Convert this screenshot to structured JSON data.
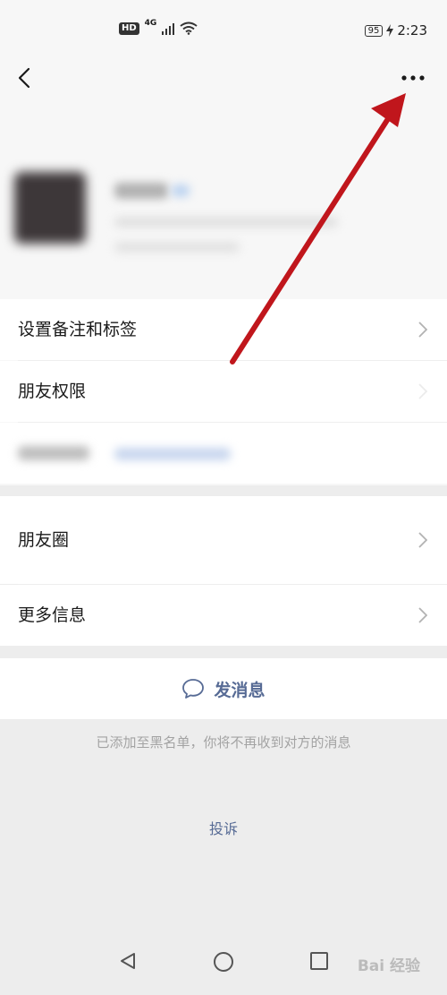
{
  "status_bar": {
    "hd": "HD",
    "network": "4G",
    "battery": "95",
    "time": "2:23"
  },
  "menu": {
    "remark_tags": "设置备注和标签",
    "friend_permissions": "朋友权限",
    "moments": "朋友圈",
    "more_info": "更多信息"
  },
  "actions": {
    "send_message": "发消息",
    "blacklist_notice": "已添加至黑名单，你将不再收到对方的消息",
    "complaint": "投诉"
  },
  "watermark": "Bai 经验",
  "colors": {
    "link_blue": "#576b95",
    "arrow_red": "#c0161c"
  },
  "icons": {
    "back": "chevron-left-icon",
    "more": "more-dots-icon",
    "chevron": "chevron-right-icon",
    "chat": "chat-bubble-icon"
  }
}
